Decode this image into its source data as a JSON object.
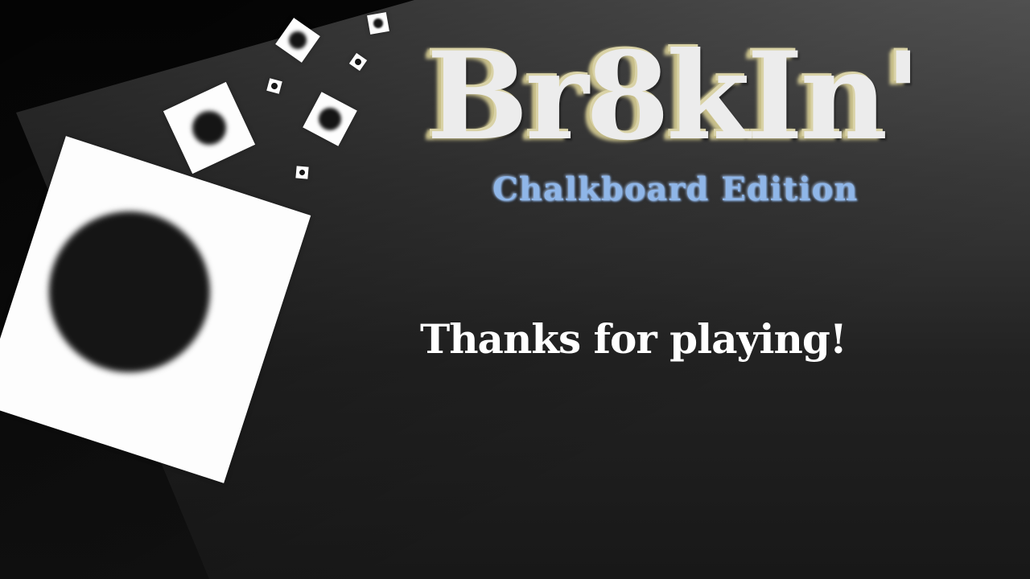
{
  "game": {
    "title": "Br8kIn'",
    "subtitle": "Chalkboard Edition",
    "message": "Thanks for playing!"
  },
  "colors": {
    "background": "#3a3a3a",
    "title": "#ececec",
    "title_outline": "#d9d2a6",
    "subtitle": "#8fb6e8",
    "message": "#ffffff",
    "tile": "#fdfdfd",
    "tile_hole": "#151515"
  }
}
